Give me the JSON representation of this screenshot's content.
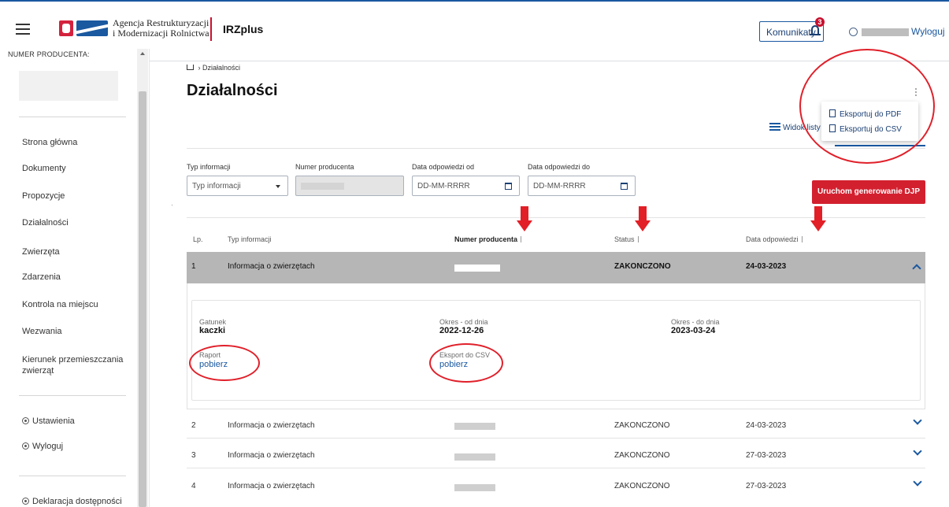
{
  "header": {
    "agency_line1": "Agencja Restrukturyzacji",
    "agency_line2": "i Modernizacji Rolnictwa",
    "app_name": "IRZplus",
    "komunikaty_label": "Komunikaty",
    "komunikaty_count": "3",
    "logout_label": "Wyloguj"
  },
  "sidebar": {
    "producer_label": "NUMER PRODUCENTA:",
    "items": [
      {
        "label": "Strona główna"
      },
      {
        "label": "Dokumenty"
      },
      {
        "label": "Propozycje"
      },
      {
        "label": "Działalności"
      },
      {
        "label": "Zwierzęta"
      },
      {
        "label": "Zdarzenia"
      },
      {
        "label": "Kontrola na miejscu"
      },
      {
        "label": "Wezwania"
      },
      {
        "label": "Kierunek przemieszczania zwierząt"
      }
    ],
    "settings_label": "Ustawienia",
    "logout_label": "Wyloguj",
    "accessibility_label": "Deklaracja dostępności"
  },
  "breadcrumb": {
    "current": "Działalności"
  },
  "page_title": "Działalności",
  "view_list_label": "Widok listy",
  "export_menu": {
    "pdf": "Eksportuj do PDF",
    "csv": "Eksportuj do CSV"
  },
  "filters": {
    "type_label": "Typ informacji",
    "type_placeholder": "Typ informacji",
    "producer_label": "Numer producenta",
    "date_from_label": "Data odpowiedzi od",
    "date_from_placeholder": "DD-MM-RRRR",
    "date_to_label": "Data odpowiedzi do",
    "date_to_placeholder": "DD-MM-RRRR"
  },
  "generate_button": "Uruchom generowanie DJP",
  "table": {
    "headers": {
      "lp": "Lp.",
      "type": "Typ informacji",
      "producer": "Numer producenta",
      "status": "Status",
      "date": "Data odpowiedzi"
    },
    "rows": [
      {
        "lp": "1",
        "type": "Informacja o zwierzętach",
        "status": "ZAKONCZONO",
        "date": "24-03-2023"
      },
      {
        "lp": "2",
        "type": "Informacja o zwierzętach",
        "status": "ZAKONCZONO",
        "date": "24-03-2023"
      },
      {
        "lp": "3",
        "type": "Informacja o zwierzętach",
        "status": "ZAKONCZONO",
        "date": "27-03-2023"
      },
      {
        "lp": "4",
        "type": "Informacja o zwierzętach",
        "status": "ZAKONCZONO",
        "date": "27-03-2023"
      }
    ]
  },
  "details": {
    "species_label": "Gatunek",
    "species_value": "kaczki",
    "from_label": "Okres - od dnia",
    "from_value": "2022-12-26",
    "to_label": "Okres - do dnia",
    "to_value": "2023-03-24",
    "report_label": "Raport",
    "report_link": "pobierz",
    "csv_label": "Eksport do CSV",
    "csv_link": "pobierz"
  },
  "colors": {
    "brand_blue": "#1a58a0",
    "brand_red": "#d3202f",
    "annotation_red": "#e21f26",
    "active_row": "#b6b6b6"
  }
}
